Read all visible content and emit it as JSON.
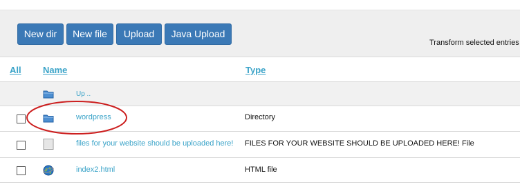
{
  "toolbar": {
    "buttons": [
      {
        "label": "New dir"
      },
      {
        "label": "New file"
      },
      {
        "label": "Upload"
      },
      {
        "label": "Java Upload"
      }
    ],
    "transform_label": "Transform selected entries"
  },
  "table": {
    "headers": {
      "all": "All",
      "name": "Name",
      "type": "Type"
    },
    "up_label": "Up ..",
    "rows": [
      {
        "name": "wordpress",
        "type": "Directory",
        "icon": "folder-icon"
      },
      {
        "name": "files for your website should be uploaded here!",
        "type": "FILES FOR YOUR WEBSITE SHOULD BE UPLOADED HERE! File",
        "icon": "file-icon"
      },
      {
        "name": "index2.html",
        "type": "HTML file",
        "icon": "globe-icon"
      }
    ]
  },
  "colors": {
    "button_bg": "#3b79b6",
    "link": "#3aa3c8",
    "annotation": "#cc1f1f"
  },
  "annotation": {
    "shape": "ellipse",
    "target": "wordpress"
  }
}
